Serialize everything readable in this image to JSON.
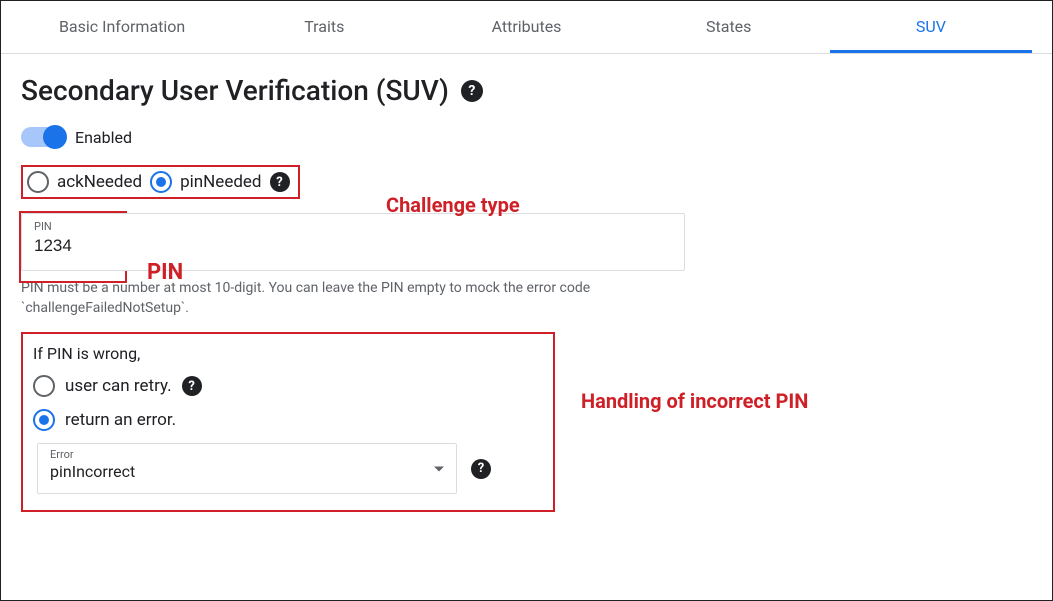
{
  "tabs": {
    "items": [
      {
        "label": "Basic Information",
        "active": false
      },
      {
        "label": "Traits",
        "active": false
      },
      {
        "label": "Attributes",
        "active": false
      },
      {
        "label": "States",
        "active": false
      },
      {
        "label": "SUV",
        "active": true
      }
    ]
  },
  "heading": "Secondary User Verification (SUV)",
  "enabled": {
    "label": "Enabled",
    "value": true
  },
  "challenge": {
    "options": [
      {
        "label": "ackNeeded",
        "selected": false
      },
      {
        "label": "pinNeeded",
        "selected": true
      }
    ]
  },
  "pin": {
    "label": "PIN",
    "value": "1234",
    "helper": "PIN must be a number at most 10-digit. You can leave the PIN empty to mock the error code `challengeFailedNotSetup`."
  },
  "wrongPin": {
    "heading": "If PIN is wrong,",
    "options": [
      {
        "label": "user can retry.",
        "selected": false
      },
      {
        "label": "return an error.",
        "selected": true
      }
    ],
    "errorSelect": {
      "label": "Error",
      "value": "pinIncorrect"
    }
  },
  "annotations": {
    "challenge": "Challenge type",
    "pin": "PIN",
    "handling": "Handling of incorrect PIN"
  }
}
